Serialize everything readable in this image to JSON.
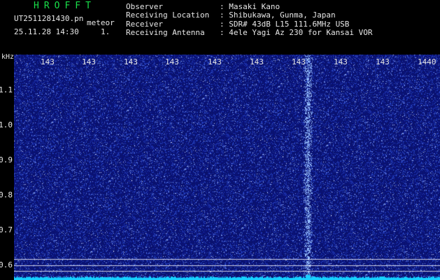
{
  "header": {
    "app_title": "HROFFT",
    "file_name": "UT2511281430.pn",
    "tag": "meteor",
    "datetime": "25.11.28 14:30",
    "count": "1.",
    "info": [
      {
        "key": "Observer",
        "value": ": Masaki Kano"
      },
      {
        "key": "Receiving Location",
        "value": ": Shibukawa, Gunma, Japan"
      },
      {
        "key": "Receiver",
        "value": ": SDR# 43dB L15 111.6MHz USB"
      },
      {
        "key": "Receiving Antenna",
        "value": ": 4ele Yagi Az 230 for Kansai VOR"
      }
    ]
  },
  "spectrogram": {
    "y_unit": "kHz",
    "y_ticks": [
      "1.1",
      "1.0",
      "0.9",
      "0.8",
      "0.7",
      "0.6"
    ],
    "y_range": [
      0.58,
      1.14
    ],
    "time_ticks": [
      "143",
      "143",
      "143",
      "143",
      "143",
      "143",
      "143",
      "143",
      "143",
      "1440"
    ],
    "trail_y_khz": 0.61,
    "colors": {
      "background": "#0a1470",
      "speckle": "#3b58d8",
      "bright": "#bcd4ff",
      "noise_floor": "#18d0ff",
      "trail": "#ffffff",
      "meteor_echo": "#9fc6ff"
    }
  }
}
